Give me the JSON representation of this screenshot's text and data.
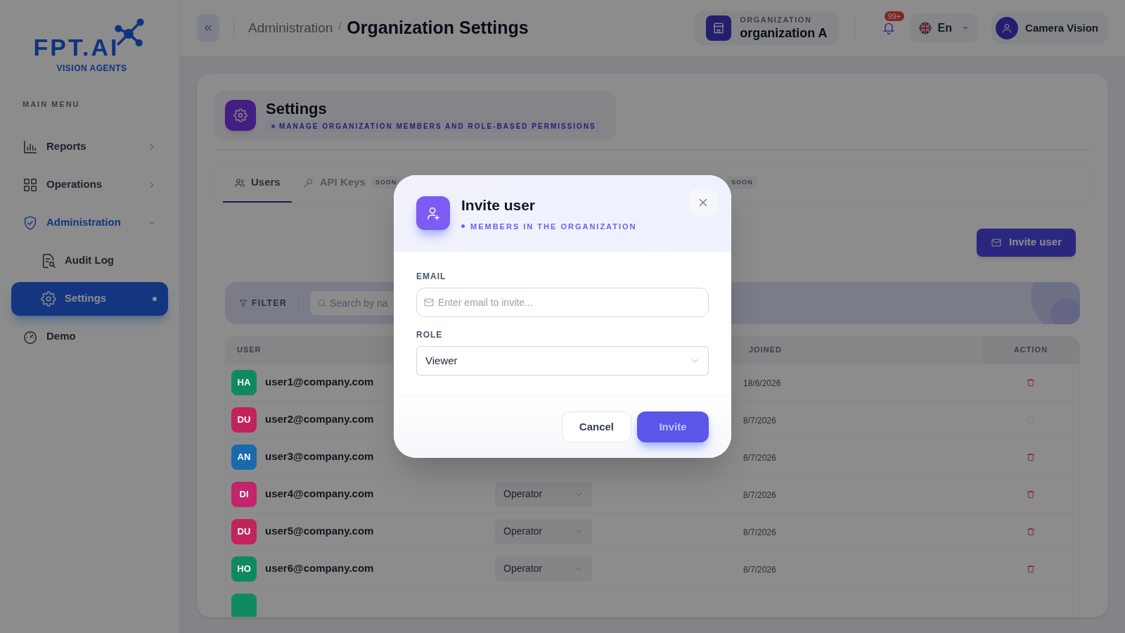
{
  "sidebar": {
    "logo": {
      "brand": "FPT.AI",
      "tagline": "VISION AGENTS"
    },
    "section_label": "MAIN MENU",
    "items": [
      {
        "label": "Reports",
        "expanded": false,
        "selected": false
      },
      {
        "label": "Operations",
        "expanded": false,
        "selected": false
      },
      {
        "label": "Administration",
        "expanded": true,
        "selected": false,
        "children": [
          {
            "label": "Audit Log",
            "selected": false
          },
          {
            "label": "Settings",
            "selected": true
          }
        ]
      },
      {
        "label": "Demo",
        "selected": false
      }
    ]
  },
  "header": {
    "breadcrumb": "Administration",
    "separator": "/",
    "title": "Organization Settings",
    "organization": {
      "label": "ORGANIZATION",
      "name": "organization A"
    },
    "notifications": "99+",
    "language": "En",
    "user": "Camera Vision"
  },
  "page": {
    "title": "Settings",
    "subtitle": "MANAGE ORGANIZATION MEMBERS AND ROLE-BASED PERMISSIONS",
    "tabs": [
      {
        "label": "Users",
        "selected": true,
        "disabled": false
      },
      {
        "label": "API Keys",
        "badge": "SOON",
        "selected": false,
        "disabled": true
      },
      {
        "badge": "SOON",
        "selected": false
      }
    ],
    "invite_button": "Invite user",
    "filter": {
      "label": "FILTER",
      "placeholder": "Search by na"
    },
    "table": {
      "columns": [
        {
          "label": "USER"
        },
        {
          "label": "JOINED"
        },
        {
          "label": "ACTION"
        }
      ],
      "rows": [
        {
          "initials": "HA",
          "color": "#0f8a60",
          "email": "user1@company.com",
          "joined": "18/6/2026",
          "delete_disabled": false
        },
        {
          "initials": "DU",
          "color": "#c0245a",
          "email": "user2@company.com",
          "joined": "8/7/2026",
          "delete_disabled": true
        },
        {
          "initials": "AN",
          "color": "#1b69ab",
          "email": "user3@company.com",
          "joined": "8/7/2026",
          "delete_disabled": false
        },
        {
          "initials": "DI",
          "color": "#c1256a",
          "email": "user4@company.com",
          "role": "Operator",
          "joined": "8/7/2026",
          "delete_disabled": false
        },
        {
          "initials": "DU",
          "color": "#c0245a",
          "email": "user5@company.com",
          "role": "Operator",
          "joined": "8/7/2026",
          "delete_disabled": false
        },
        {
          "initials": "HO",
          "color": "#0f8a60",
          "email": "user6@company.com",
          "role": "Operator",
          "joined": "8/7/2026",
          "delete_disabled": false
        },
        {
          "color": "#0f8a60"
        }
      ]
    }
  },
  "modal": {
    "title": "Invite user",
    "subtitle": "MEMBERS IN THE ORGANIZATION",
    "email": {
      "label": "EMAIL",
      "placeholder": "Enter email to invite..."
    },
    "role": {
      "label": "ROLE",
      "value": "Viewer"
    },
    "cancel": "Cancel",
    "submit": {
      "label": "Invite",
      "disabled": true
    }
  }
}
